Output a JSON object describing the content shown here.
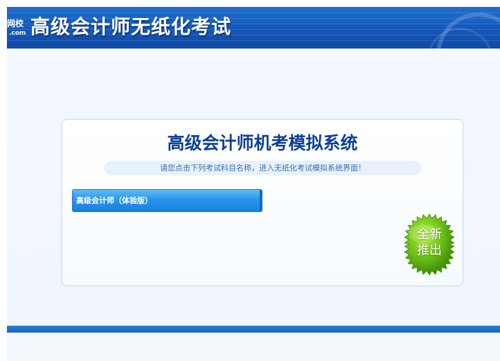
{
  "header": {
    "logo_text": "网校",
    "logo_sub": ".com",
    "title": "高级会计师无纸化考试"
  },
  "main": {
    "title": "高级会计师机考模拟系统",
    "instruction": "请您点击下列考试科目名称，进入无纸化考试模拟系统界面！",
    "exam_items": [
      {
        "label": "高级会计师（体验版）"
      }
    ],
    "badge": {
      "line1": "全新",
      "line2": "推出"
    }
  },
  "colors": {
    "header_blue": "#1557b8",
    "title_blue": "#0e3f96",
    "button_blue": "#2b95ec",
    "badge_green": "#6fc21a"
  }
}
